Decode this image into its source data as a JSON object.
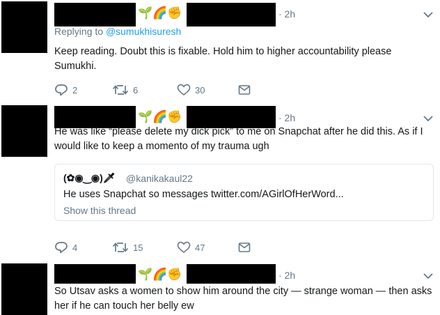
{
  "tweets": [
    {
      "emoji": "🌱🌈✊",
      "time": "· 2h",
      "reply_prefix": "Replying to",
      "reply_mention": "@sumukhisuresh",
      "text": "Keep reading. Doubt this is fixable. Hold him to higher accountability please Sumukhi.",
      "replies": "2",
      "retweets": "6",
      "likes": "30"
    },
    {
      "emoji": "🌱🌈✊",
      "time": "· 2h",
      "text": "He was like “please delete my dick pick” to me on Snapchat after he did this. As if I would like to keep a momento of my trauma ugh",
      "quote": {
        "name": "(✿◉‿◉)🗡",
        "handle": "@kanikakaul22",
        "text": "He uses Snapchat so messages twitter.com/AGirlOfHerWord...",
        "thread_link": "Show this thread"
      },
      "replies": "4",
      "retweets": "15",
      "likes": "47"
    },
    {
      "emoji": "🌱🌈✊",
      "time": "· 2h",
      "text": "So Utsav asks a women to show him around the city — strange woman — then asks her if he can touch her belly ew"
    }
  ],
  "icons": {
    "reply": "reply-icon",
    "retweet": "retweet-icon",
    "like": "heart-icon",
    "dm": "envelope-icon",
    "more": "chevron-down-icon"
  },
  "colors": {
    "secondary_text": "#657786",
    "link": "#1da1f2",
    "divider": "#e6ecf0"
  }
}
